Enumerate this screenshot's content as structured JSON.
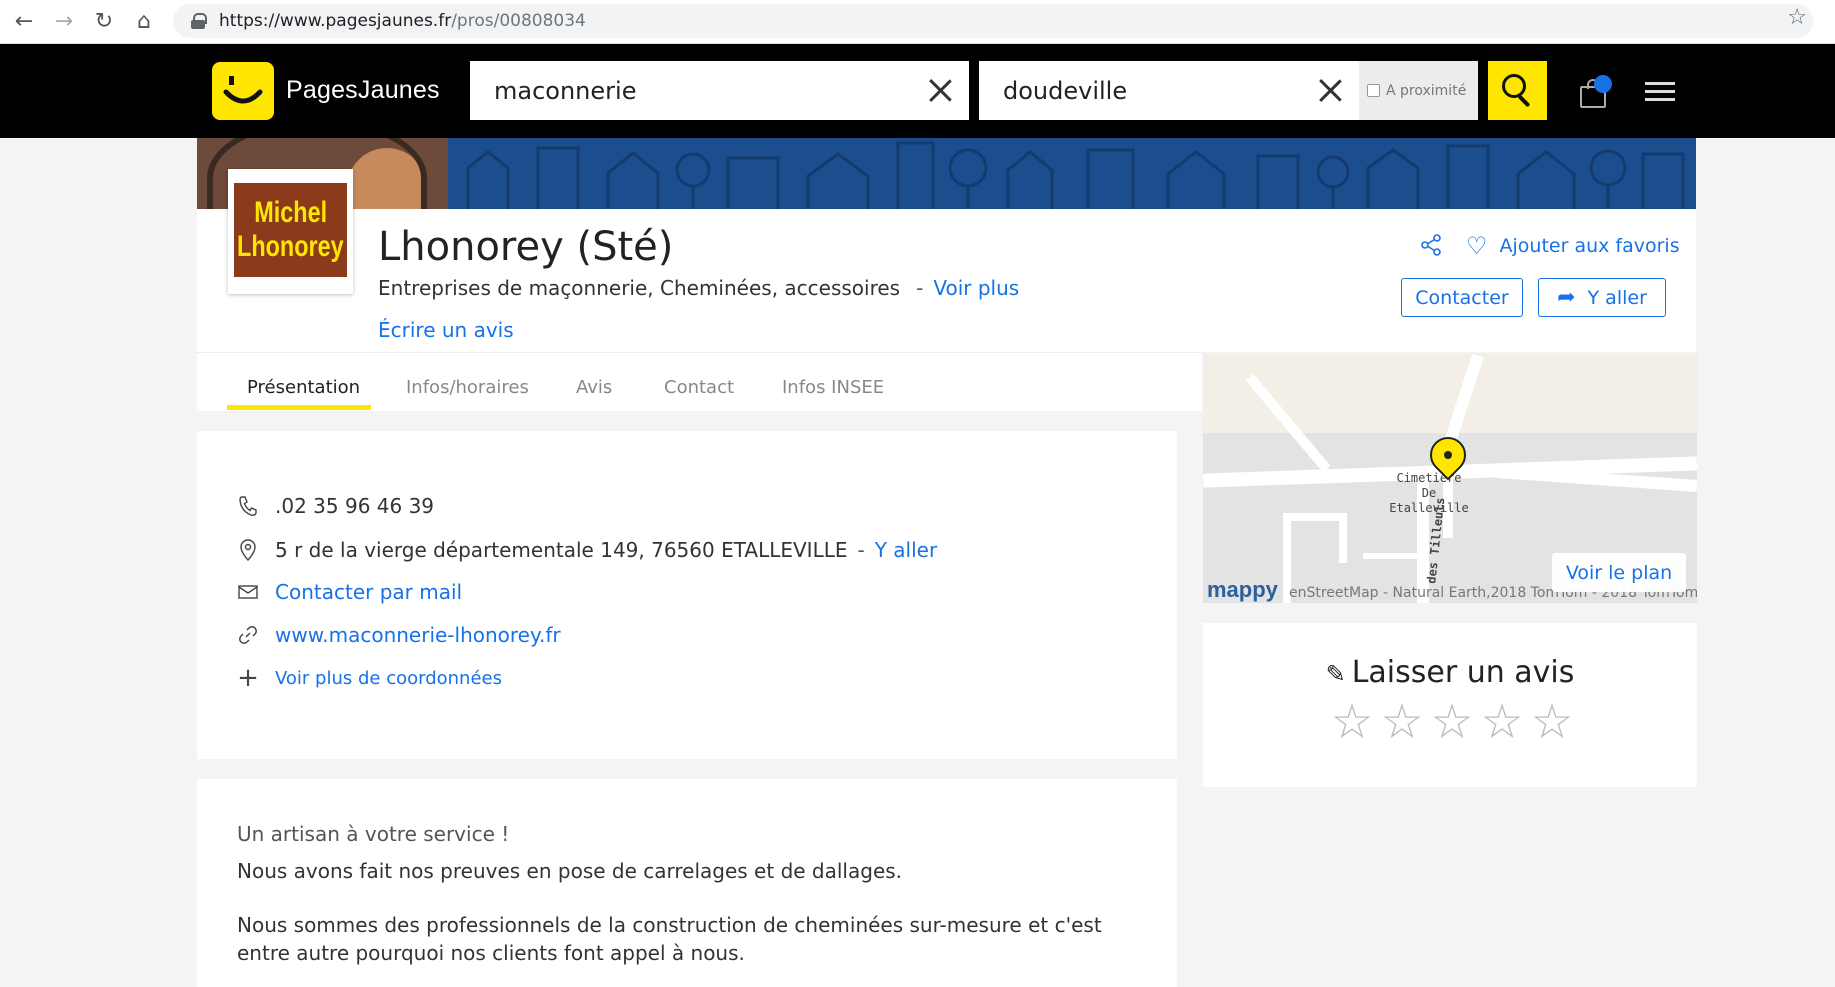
{
  "browser": {
    "url_host": "https://www.pagesjaunes.fr",
    "url_path": "/pros/00808034"
  },
  "header": {
    "brand": "PagesJaunes",
    "what_value": "maconnerie",
    "where_value": "doudeville",
    "proximity_label": "A proximité"
  },
  "logo": {
    "line1": "Michel",
    "line2": "Lhonorey"
  },
  "business": {
    "name": "Lhonorey (Sté)",
    "categories": "Entreprises de maçonnerie, Cheminées, accessoires",
    "more_label": "Voir plus",
    "write_review": "Écrire un avis",
    "favorite_label": "Ajouter aux favoris",
    "contact_label": "Contacter",
    "go_label": "Y aller"
  },
  "tabs": [
    {
      "label": "Présentation",
      "active": true
    },
    {
      "label": "Infos/horaires",
      "active": false
    },
    {
      "label": "Avis",
      "active": false
    },
    {
      "label": "Contact",
      "active": false
    },
    {
      "label": "Infos INSEE",
      "active": false
    }
  ],
  "map": {
    "place_line1": "Cimetière De",
    "place_line2": "Etalleville",
    "street": "des Tilleuls",
    "brand": "mappy",
    "attribution": "enStreetMap - Natural Earth,2018 TomTom - 2018 TomTom",
    "button": "Voir le plan"
  },
  "contact": {
    "phone": ".02 35 96 46 39",
    "address": "5 r de la vierge départementale 149, 76560 ETALLEVILLE",
    "address_link": "Y aller",
    "mail_link": "Contacter par mail",
    "website": "www.maconnerie-lhonorey.fr",
    "more_coords": "Voir plus de coordonnées"
  },
  "review": {
    "title": "Laisser un avis",
    "stars": 0
  },
  "description": {
    "tagline": "Un artisan à votre service !",
    "paragraph1": "Nous avons fait nos preuves en pose de carrelages et de dallages.",
    "paragraph2": "Nous sommes des professionnels de la construction de cheminées sur-mesure et c'est entre autre pourquoi nos clients font appel à nous."
  },
  "colors": {
    "brand_yellow": "#ffe600",
    "link_blue": "#1672e6",
    "header_black": "#000000"
  }
}
